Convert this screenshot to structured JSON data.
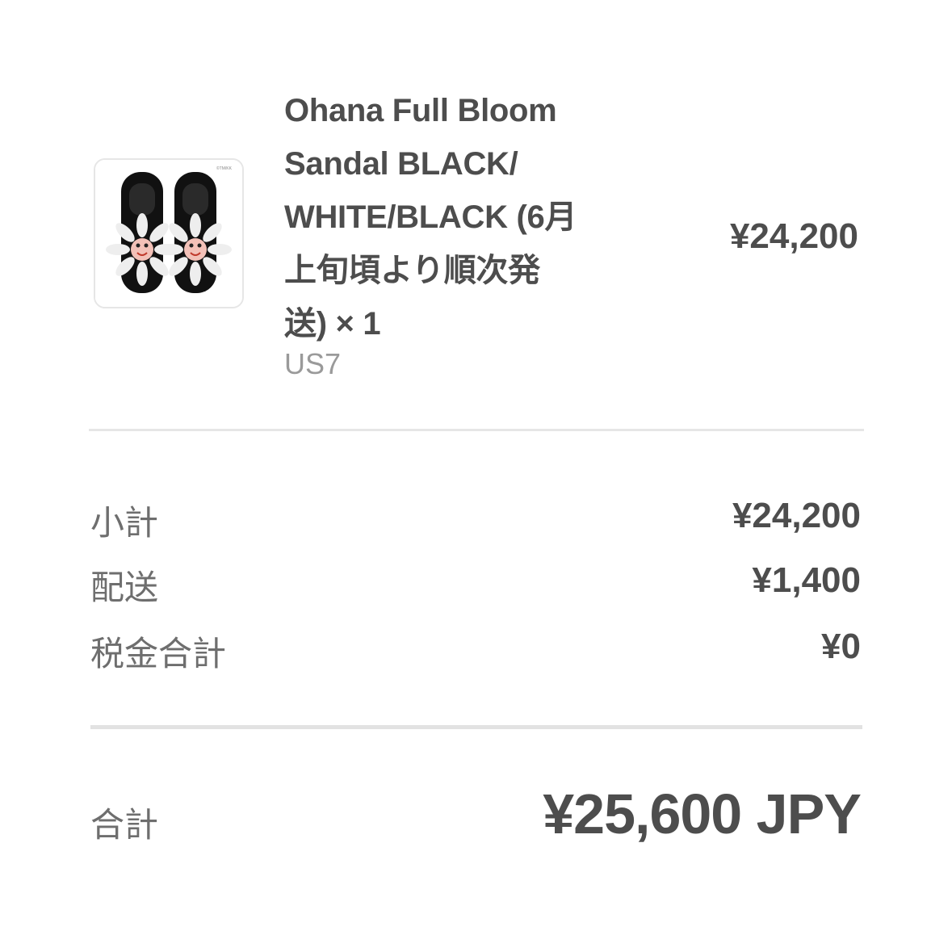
{
  "line_item": {
    "title": "Ohana Full Bloom\nSandal BLACK/\nWHITE/BLACK (6月\n上旬頃より順次発\n送) × 1",
    "variant": "US7",
    "price": "¥24,200",
    "image_watermark": "©TM/KK"
  },
  "summary": {
    "rows": [
      {
        "label": "小計",
        "value": "¥24,200"
      },
      {
        "label": "配送",
        "value": "¥1,400"
      },
      {
        "label": "税金合計",
        "value": "¥0"
      }
    ]
  },
  "total": {
    "label": "合計",
    "value": "¥25,600 JPY"
  },
  "colors": {
    "text": "#4d4d4d",
    "muted": "#6e6e6e",
    "variant": "#9a9a9a",
    "divider": "#e6e6e6"
  }
}
